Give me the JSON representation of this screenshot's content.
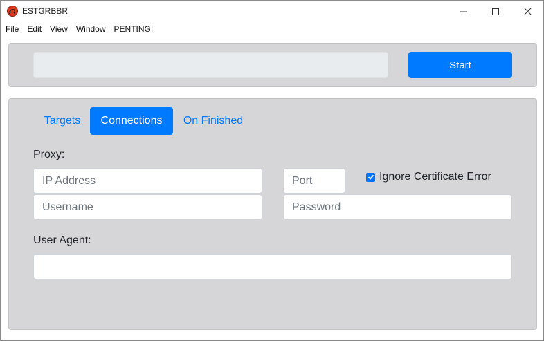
{
  "window": {
    "title": "ESTGRBBR",
    "controls": {
      "minimize": "minimize",
      "maximize": "maximize",
      "close": "close"
    }
  },
  "menu": [
    "File",
    "Edit",
    "View",
    "Window",
    "PENTING!"
  ],
  "top": {
    "url_value": "",
    "start_label": "Start"
  },
  "tabs": [
    {
      "label": "Targets",
      "active": false
    },
    {
      "label": "Connections",
      "active": true
    },
    {
      "label": "On Finished",
      "active": false
    }
  ],
  "proxy": {
    "section_label": "Proxy:",
    "ip_placeholder": "IP Address",
    "port_placeholder": "Port",
    "username_placeholder": "Username",
    "password_placeholder": "Password",
    "ignore_cert_label": "Ignore Certificate Error",
    "ignore_cert_checked": true
  },
  "user_agent": {
    "label": "User Agent:",
    "value": ""
  },
  "colors": {
    "accent": "#007bff",
    "panel": "#d6d6d8",
    "disabled_input": "#e9ecef"
  },
  "icons": {
    "app": "app-logo-icon",
    "minimize": "minimize-icon",
    "maximize": "maximize-icon",
    "close": "close-icon",
    "checkbox": "checkmark-icon"
  }
}
